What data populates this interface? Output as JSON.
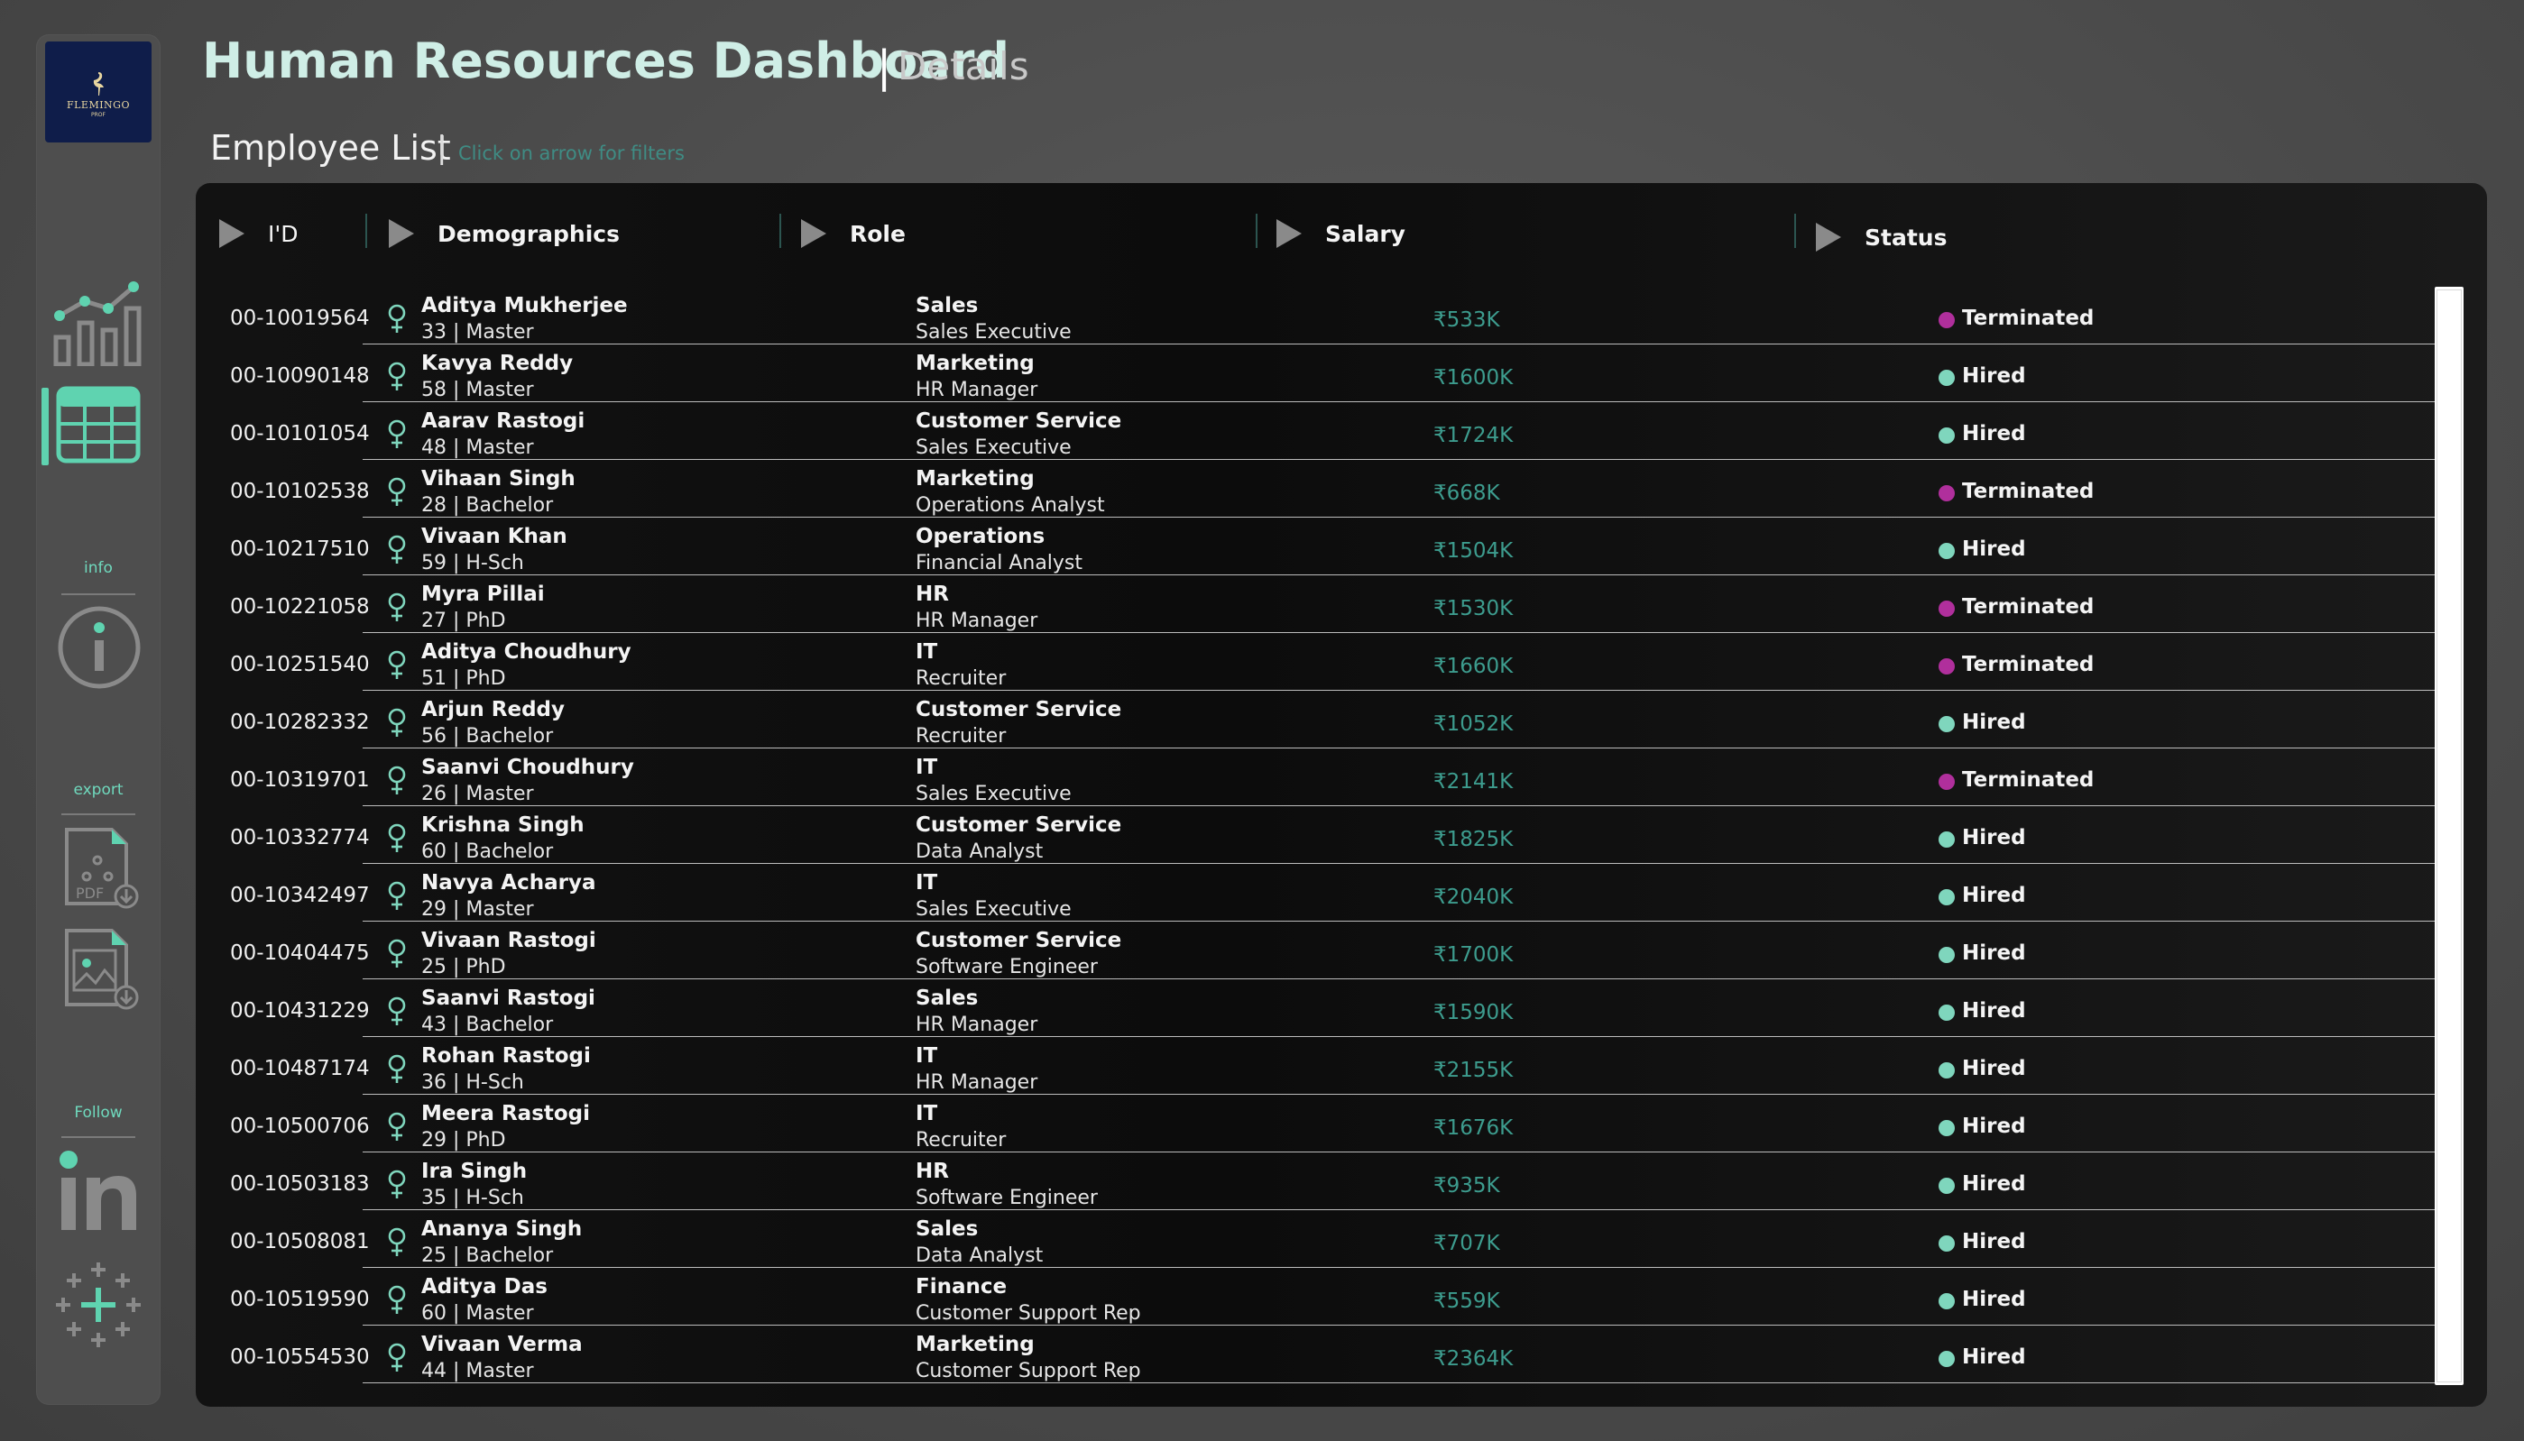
{
  "header": {
    "title": "Human Resources Dashboard",
    "separator": "|",
    "subtitle": "Details"
  },
  "list": {
    "title": "Employee List",
    "separator": "|",
    "hint": "Click on arrow for filters"
  },
  "logo": {
    "brand": "FLEMINGO",
    "sub": "PROF"
  },
  "sidebar": {
    "info_label": "info",
    "export_label": "export",
    "follow_label": "Follow",
    "pdf_text": "PDF"
  },
  "columns": {
    "id": "I'D",
    "demographics": "Demographics",
    "role": "Role",
    "salary": "Salary",
    "status": "Status"
  },
  "colors": {
    "accent": "#5fd3b0",
    "hired": "#7fd6bd",
    "terminated": "#b02f9c",
    "salary": "#3d9c8e"
  },
  "employees": [
    {
      "id": "00-10019564",
      "name": "Aditya Mukherjee",
      "demo": "33 | Master",
      "dept": "Sales",
      "job": "Sales Executive",
      "salary": "₹533K",
      "status": "Terminated"
    },
    {
      "id": "00-10090148",
      "name": "Kavya Reddy",
      "demo": "58 | Master",
      "dept": "Marketing",
      "job": "HR Manager",
      "salary": "₹1600K",
      "status": "Hired"
    },
    {
      "id": "00-10101054",
      "name": "Aarav Rastogi",
      "demo": "48 | Master",
      "dept": "Customer Service",
      "job": "Sales Executive",
      "salary": "₹1724K",
      "status": "Hired"
    },
    {
      "id": "00-10102538",
      "name": "Vihaan Singh",
      "demo": "28 | Bachelor",
      "dept": "Marketing",
      "job": "Operations Analyst",
      "salary": "₹668K",
      "status": "Terminated"
    },
    {
      "id": "00-10217510",
      "name": "Vivaan Khan",
      "demo": "59 | H-Sch",
      "dept": "Operations",
      "job": "Financial Analyst",
      "salary": "₹1504K",
      "status": "Hired"
    },
    {
      "id": "00-10221058",
      "name": "Myra Pillai",
      "demo": "27 | PhD",
      "dept": "HR",
      "job": "HR Manager",
      "salary": "₹1530K",
      "status": "Terminated"
    },
    {
      "id": "00-10251540",
      "name": "Aditya Choudhury",
      "demo": "51 | PhD",
      "dept": "IT",
      "job": "Recruiter",
      "salary": "₹1660K",
      "status": "Terminated"
    },
    {
      "id": "00-10282332",
      "name": "Arjun Reddy",
      "demo": "56 | Bachelor",
      "dept": "Customer Service",
      "job": "Recruiter",
      "salary": "₹1052K",
      "status": "Hired"
    },
    {
      "id": "00-10319701",
      "name": "Saanvi Choudhury",
      "demo": "26 | Master",
      "dept": "IT",
      "job": "Sales Executive",
      "salary": "₹2141K",
      "status": "Terminated"
    },
    {
      "id": "00-10332774",
      "name": "Krishna Singh",
      "demo": "60 | Bachelor",
      "dept": "Customer Service",
      "job": "Data Analyst",
      "salary": "₹1825K",
      "status": "Hired"
    },
    {
      "id": "00-10342497",
      "name": "Navya Acharya",
      "demo": "29 | Master",
      "dept": "IT",
      "job": "Sales Executive",
      "salary": "₹2040K",
      "status": "Hired"
    },
    {
      "id": "00-10404475",
      "name": "Vivaan Rastogi",
      "demo": "25 | PhD",
      "dept": "Customer Service",
      "job": "Software Engineer",
      "salary": "₹1700K",
      "status": "Hired"
    },
    {
      "id": "00-10431229",
      "name": "Saanvi Rastogi",
      "demo": "43 | Bachelor",
      "dept": "Sales",
      "job": "HR Manager",
      "salary": "₹1590K",
      "status": "Hired"
    },
    {
      "id": "00-10487174",
      "name": "Rohan Rastogi",
      "demo": "36 | H-Sch",
      "dept": "IT",
      "job": "HR Manager",
      "salary": "₹2155K",
      "status": "Hired"
    },
    {
      "id": "00-10500706",
      "name": "Meera Rastogi",
      "demo": "29 | PhD",
      "dept": "IT",
      "job": "Recruiter",
      "salary": "₹1676K",
      "status": "Hired"
    },
    {
      "id": "00-10503183",
      "name": "Ira Singh",
      "demo": "35 | H-Sch",
      "dept": "HR",
      "job": "Software Engineer",
      "salary": "₹935K",
      "status": "Hired"
    },
    {
      "id": "00-10508081",
      "name": "Ananya Singh",
      "demo": "25 | Bachelor",
      "dept": "Sales",
      "job": "Data Analyst",
      "salary": "₹707K",
      "status": "Hired"
    },
    {
      "id": "00-10519590",
      "name": "Aditya Das",
      "demo": "60 | Master",
      "dept": "Finance",
      "job": "Customer Support Rep",
      "salary": "₹559K",
      "status": "Hired"
    },
    {
      "id": "00-10554530",
      "name": "Vivaan Verma",
      "demo": "44 | Master",
      "dept": "Marketing",
      "job": "Customer Support Rep",
      "salary": "₹2364K",
      "status": "Hired"
    }
  ]
}
